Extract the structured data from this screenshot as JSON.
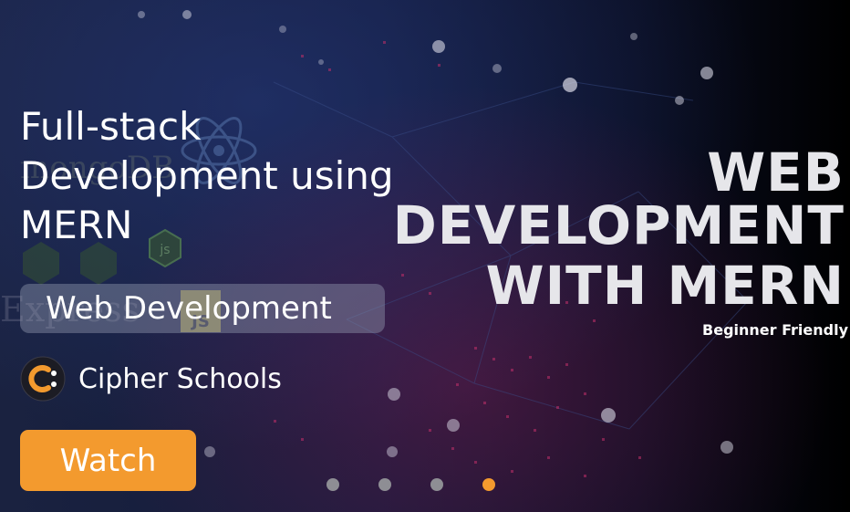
{
  "banner": {
    "headline_line1": "WEB DEVELOPMENT",
    "headline_line2": "WITH MERN",
    "headline_tag": "Beginner Friendly",
    "course_title": "Full-stack Development using MERN",
    "category": "Web Development",
    "provider": {
      "name": "Cipher Schools",
      "logo_icon": "cipher-schools-logo-icon"
    },
    "watch_label": "Watch",
    "carousel": {
      "count": 4,
      "active_index": 3
    },
    "bg_logos": {
      "mongodb": "mongoDB",
      "express": "Express",
      "js_badge": "JS",
      "node_badge": "js"
    },
    "colors": {
      "accent": "#f39a2e",
      "dot_inactive": "#8e8e94",
      "pill_bg": "#7d8398",
      "text": "#ffffff"
    }
  }
}
